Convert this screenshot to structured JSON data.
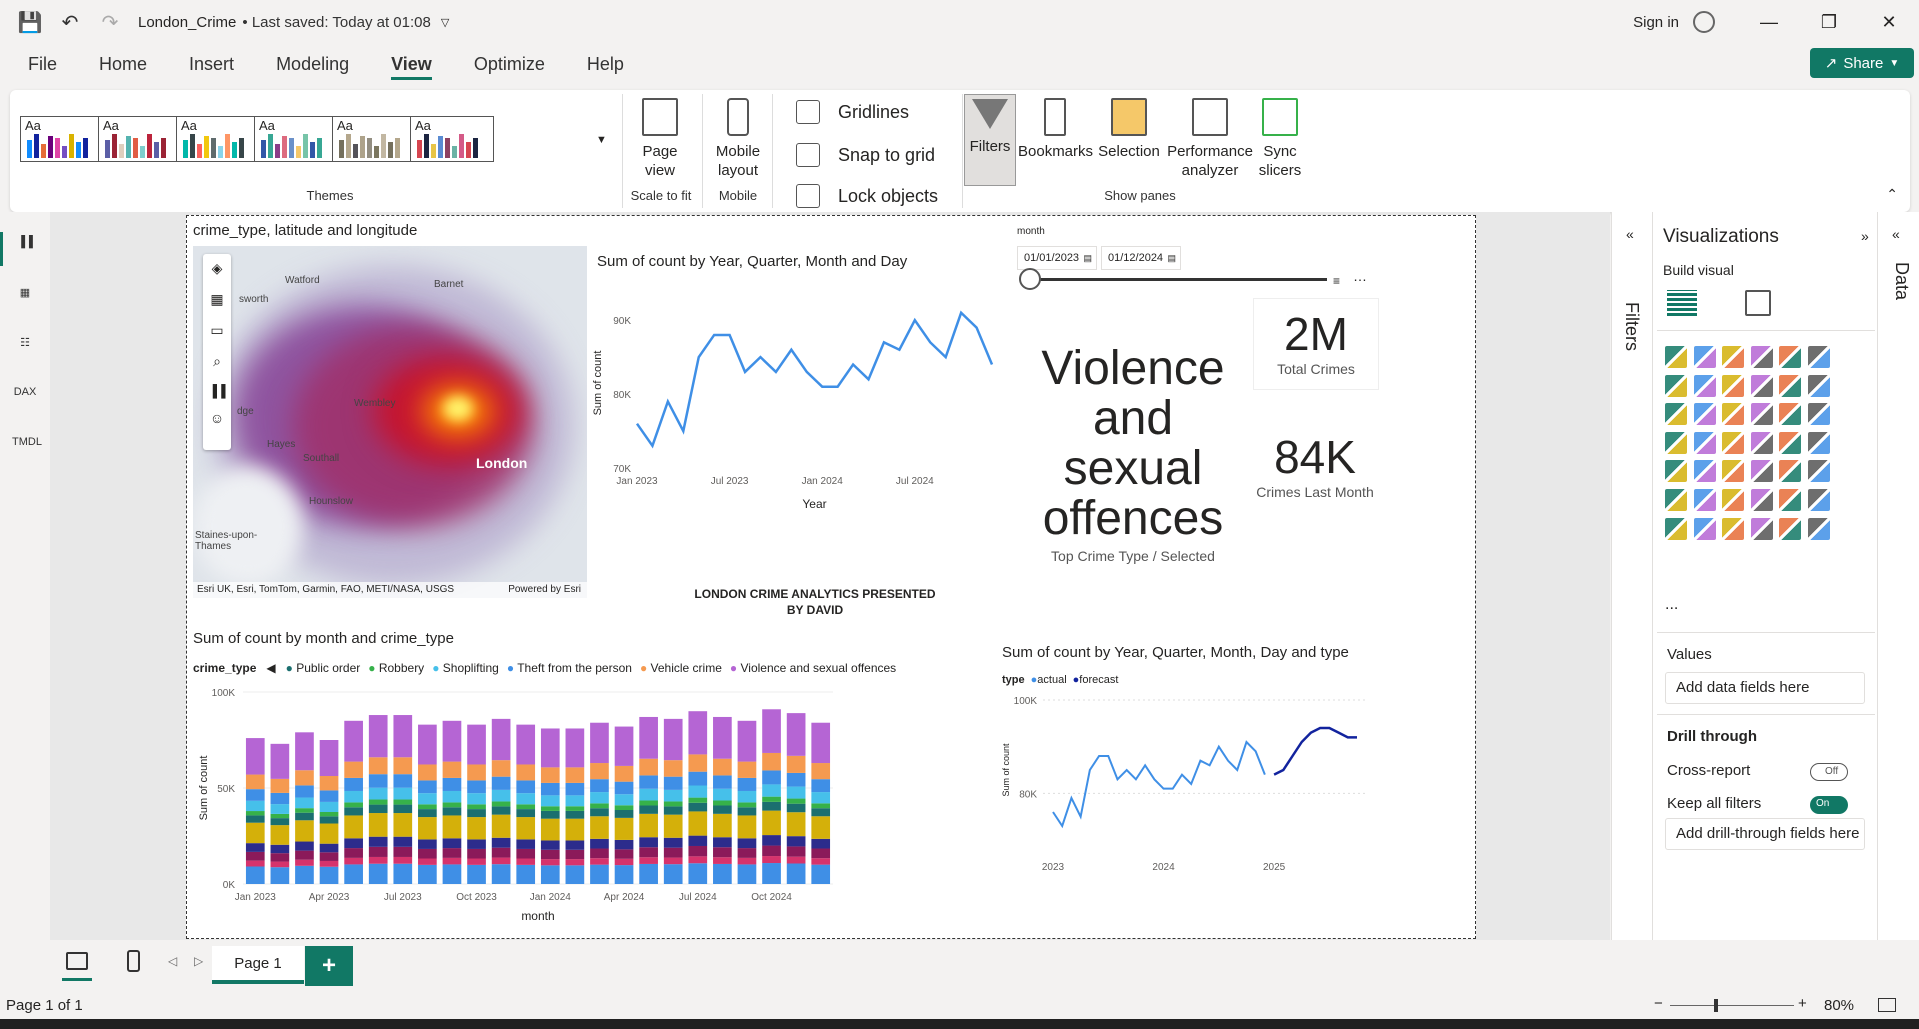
{
  "titlebar": {
    "file_title": "London_Crime",
    "saved": "• Last saved: Today at 01:08",
    "signin": "Sign in"
  },
  "menu": {
    "items": [
      "File",
      "Home",
      "Insert",
      "Modeling",
      "View",
      "Optimize",
      "Help"
    ],
    "active": "View",
    "share": "Share"
  },
  "ribbon": {
    "themes_label": "Themes",
    "theme_palettes": [
      [
        "#118dff",
        "#12239e",
        "#e66c37",
        "#6b007b",
        "#e044a7",
        "#744ec2",
        "#d9b300"
      ],
      [
        "#5b5ea6",
        "#9b2335",
        "#dfcfbe",
        "#55b4b0",
        "#e15d44",
        "#7fcdcd",
        "#bc243c"
      ],
      [
        "#01b8aa",
        "#374649",
        "#fd625e",
        "#f2c80f",
        "#5f6b6d",
        "#8ad4eb",
        "#fe9666"
      ],
      [
        "#3257a8",
        "#37a794",
        "#8b3d88",
        "#dd6b7f",
        "#6b91c9",
        "#f5c869",
        "#77c4a8"
      ],
      [
        "#75705d",
        "#b4a78c",
        "#54535a",
        "#aea38b",
        "#938e81",
        "#7c7760",
        "#c2b7a2"
      ],
      [
        "#d64550",
        "#1c2541",
        "#e8c547",
        "#5a8bd2",
        "#8e4162",
        "#6bb2a5",
        "#d45a87"
      ]
    ],
    "page_view": "Page view",
    "scale_to_fit": "Scale to fit",
    "mobile_layout": "Mobile layout",
    "mobile": "Mobile",
    "gridlines": "Gridlines",
    "snap_to_grid": "Snap to grid",
    "lock_objects": "Lock objects",
    "panes": [
      "Filters",
      "Bookmarks",
      "Selection",
      "Performance analyzer",
      "Sync slicers"
    ],
    "show_panes": "Show panes"
  },
  "map": {
    "title": "crime_type, latitude and longitude",
    "labels": [
      "Watford",
      "Barnet",
      "sworth",
      "Wembley",
      "Hayes",
      "Southall",
      "London",
      "Hounslow",
      "Staines-upon-Thames",
      "dge"
    ],
    "attribution": "Esri UK, Esri, TomTom, Garmin, FAO, METI/NASA, USGS",
    "powered": "Powered by Esri"
  },
  "linechart1": {
    "title": "Sum of count by Year, Quarter, Month and Day",
    "ylabel": "Sum of count",
    "xlabel": "Year",
    "yticks": [
      "90K",
      "80K",
      "70K"
    ],
    "xticks": [
      "Jan 2023",
      "Jul 2023",
      "Jan 2024",
      "Jul 2024"
    ]
  },
  "slicer": {
    "label": "month",
    "start": "01/01/2023",
    "end": "01/12/2024"
  },
  "kpi": {
    "crime_type": "Violence and sexual offences",
    "crime_type_label": "Top Crime Type / Selected",
    "total": "2M",
    "total_label": "Total Crimes",
    "last_month": "84K",
    "last_month_label": "Crimes Last Month"
  },
  "banner": "LONDON CRIME ANALYTICS PRESENTED BY DAVID",
  "stacked": {
    "title": "Sum of count by month and crime_type",
    "legend_title": "crime_type",
    "legend": [
      {
        "name": "Public order",
        "color": "#1b6f6f"
      },
      {
        "name": "Robbery",
        "color": "#36b14a"
      },
      {
        "name": "Shoplifting",
        "color": "#46c0ea"
      },
      {
        "name": "Theft from the person",
        "color": "#3f8fe6"
      },
      {
        "name": "Vehicle crime",
        "color": "#f59a50"
      },
      {
        "name": "Violence and sexual offences",
        "color": "#b565d4"
      }
    ],
    "ylabel": "Sum of count",
    "xlabel": "month",
    "yticks": [
      "100K",
      "50K",
      "0K"
    ],
    "xticks": [
      "Jan 2023",
      "Apr 2023",
      "Jul 2023",
      "Oct 2023",
      "Jan 2024",
      "Apr 2024",
      "Jul 2024",
      "Oct 2024"
    ]
  },
  "forecast": {
    "title": "Sum of count by Year, Quarter, Month, Day and type",
    "legend_title": "type",
    "legend": [
      {
        "name": "actual",
        "color": "#3f8fe6"
      },
      {
        "name": "forecast",
        "color": "#12239e"
      }
    ],
    "ylabel": "Sum of count",
    "xlabel": "Year",
    "yticks": [
      "100K",
      "80K"
    ],
    "xticks": [
      "2023",
      "2024",
      "2025"
    ]
  },
  "panes": {
    "filters": "Filters",
    "visualizations": "Visualizations",
    "build_visual": "Build visual",
    "values": "Values",
    "add_fields": "Add data fields here",
    "drill_through": "Drill through",
    "cross_report": "Cross-report",
    "off": "Off",
    "keep_filters": "Keep all filters",
    "on": "On",
    "add_drill": "Add drill-through fields here",
    "data": "Data",
    "more": "..."
  },
  "pages": {
    "tab": "Page 1",
    "add": "+"
  },
  "status": {
    "page": "Page 1 of 1",
    "zoom": "80%"
  },
  "chart_data": [
    {
      "type": "line",
      "title": "Sum of count by Year, Quarter, Month and Day",
      "xlabel": "Year",
      "ylabel": "Sum of count",
      "x": [
        "Jan 2023",
        "Feb 2023",
        "Mar 2023",
        "Apr 2023",
        "May 2023",
        "Jun 2023",
        "Jul 2023",
        "Aug 2023",
        "Sep 2023",
        "Oct 2023",
        "Nov 2023",
        "Dec 2023",
        "Jan 2024",
        "Feb 2024",
        "Mar 2024",
        "Apr 2024",
        "May 2024",
        "Jun 2024",
        "Jul 2024",
        "Aug 2024",
        "Sep 2024",
        "Oct 2024",
        "Nov 2024",
        "Dec 2024"
      ],
      "values": [
        76,
        73,
        79,
        75,
        85,
        88,
        88,
        83,
        85,
        83,
        86,
        83,
        81,
        81,
        84,
        82,
        87,
        86,
        90,
        87,
        85,
        91,
        89,
        84
      ],
      "units": "K",
      "ylim": [
        70,
        93
      ]
    },
    {
      "type": "bar",
      "stacked": true,
      "title": "Sum of count by month and crime_type",
      "xlabel": "month",
      "ylabel": "Sum of count",
      "categories": [
        "Jan 2023",
        "Feb 2023",
        "Mar 2023",
        "Apr 2023",
        "May 2023",
        "Jun 2023",
        "Jul 2023",
        "Aug 2023",
        "Sep 2023",
        "Oct 2023",
        "Nov 2023",
        "Dec 2023",
        "Jan 2024",
        "Feb 2024",
        "Mar 2024",
        "Apr 2024",
        "May 2024",
        "Jun 2024",
        "Jul 2024",
        "Aug 2024",
        "Sep 2024",
        "Oct 2024",
        "Nov 2024",
        "Dec 2024"
      ],
      "totals": [
        76,
        73,
        79,
        75,
        85,
        88,
        88,
        83,
        85,
        83,
        86,
        83,
        81,
        81,
        84,
        82,
        87,
        86,
        90,
        87,
        85,
        91,
        89,
        84
      ],
      "units": "K",
      "ylim": [
        0,
        100
      ]
    },
    {
      "type": "line",
      "title": "Sum of count by Year, Quarter, Month, Day and type",
      "xlabel": "Year",
      "ylabel": "Sum of count",
      "series": [
        {
          "name": "actual",
          "x": [
            "2023-01",
            "2023-02",
            "2023-03",
            "2023-04",
            "2023-05",
            "2023-06",
            "2023-07",
            "2023-08",
            "2023-09",
            "2023-10",
            "2023-11",
            "2023-12",
            "2024-01",
            "2024-02",
            "2024-03",
            "2024-04",
            "2024-05",
            "2024-06",
            "2024-07",
            "2024-08",
            "2024-09",
            "2024-10",
            "2024-11",
            "2024-12"
          ],
          "values": [
            76,
            73,
            79,
            75,
            85,
            88,
            88,
            83,
            85,
            83,
            86,
            83,
            81,
            81,
            84,
            82,
            87,
            86,
            90,
            87,
            85,
            91,
            89,
            84
          ]
        },
        {
          "name": "forecast",
          "x": [
            "2025-01",
            "2025-02",
            "2025-03",
            "2025-04",
            "2025-05",
            "2025-06",
            "2025-07",
            "2025-08",
            "2025-09",
            "2025-10"
          ],
          "values": [
            84,
            85,
            88,
            91,
            93,
            94,
            94,
            93,
            92,
            92
          ]
        }
      ],
      "units": "K",
      "ylim": [
        70,
        100
      ]
    }
  ]
}
